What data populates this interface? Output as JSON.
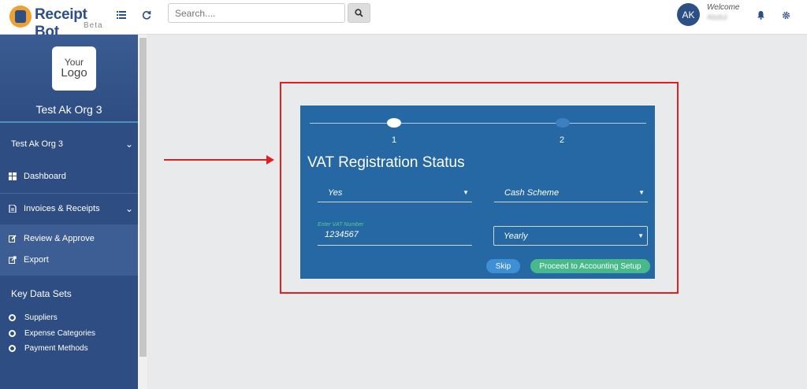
{
  "app": {
    "name": "Receipt Bot",
    "beta": "Beta"
  },
  "header": {
    "search_placeholder": "Search....",
    "avatar_initials": "AK",
    "welcome": "Welcome",
    "user_name": "Abdul"
  },
  "sidebar": {
    "logo_line1": "Your",
    "logo_line2": "Logo",
    "org_title": "Test Ak Org 3",
    "org_selector": "Test Ak Org 3",
    "dashboard": "Dashboard",
    "invoices": "Invoices & Receipts",
    "review": "Review & Approve",
    "export": "Export",
    "key_data_sets": "Key Data Sets",
    "suppliers": "Suppliers",
    "expense_categories": "Expense Categories",
    "payment_methods": "Payment Methods"
  },
  "wizard": {
    "step1": "1",
    "step2": "2",
    "title": "VAT Registration Status",
    "vat_registered": "Yes",
    "scheme": "Cash Scheme",
    "vat_label": "Enter VAT Number",
    "vat_number": "1234567",
    "period": "Yearly",
    "skip": "Skip",
    "proceed": "Proceed to Accounting Setup"
  },
  "colors": {
    "brand": "#2c4f86",
    "panel": "#2668a4",
    "accent_green": "#48b98a",
    "highlight_red": "#e02020"
  }
}
